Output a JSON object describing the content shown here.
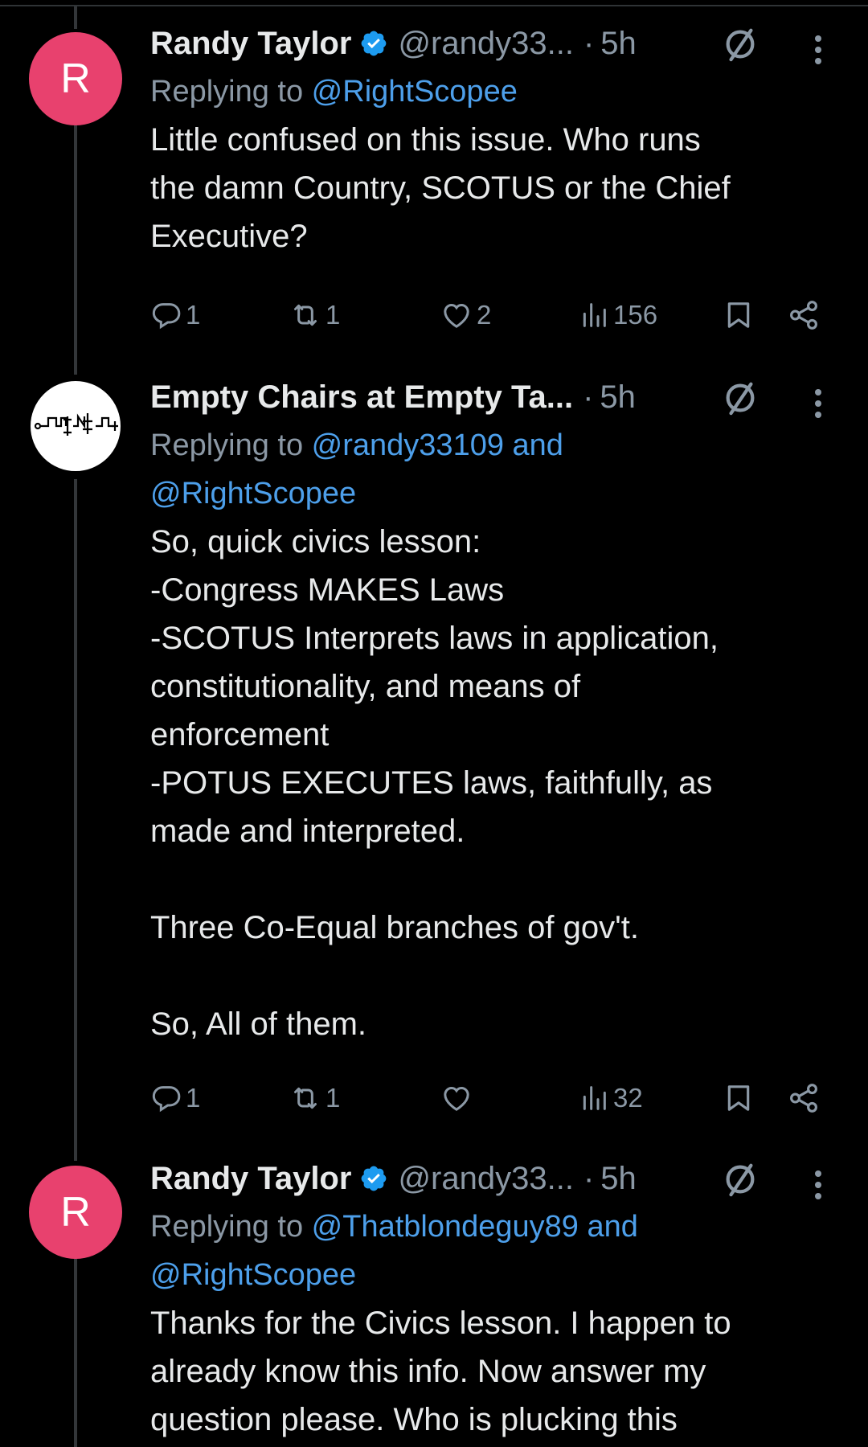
{
  "tweets": [
    {
      "name": "Randy Taylor",
      "handle": "@randy33...",
      "dot": "·",
      "time": "5h",
      "avatar_letter": "R",
      "reply_prefix": "Replying to ",
      "reply_to_1": "@RightScopee",
      "text": "Little confused on this issue. Who runs\nthe damn Country, SCOTUS or the Chief\nExecutive?",
      "replies": "1",
      "reposts": "1",
      "likes": "2",
      "views": "156"
    },
    {
      "name": "Empty Chairs at Empty Ta...",
      "dot": "·",
      "time": "5h",
      "reply_prefix": "Replying to ",
      "reply_to_1": "@randy33109 and",
      "reply_to_2": "@RightScopee",
      "text": "So, quick civics lesson:\n-Congress MAKES Laws\n-SCOTUS Interprets laws in application,\nconstitutionality, and means of\nenforcement\n-POTUS EXECUTES laws, faithfully, as\nmade and interpreted.\n\nThree Co-Equal branches of gov't.\n\nSo, All of them.",
      "replies": "1",
      "reposts": "1",
      "likes": "",
      "views": "32"
    },
    {
      "name": "Randy Taylor",
      "handle": "@randy33...",
      "dot": "·",
      "time": "5h",
      "avatar_letter": "R",
      "reply_prefix": "Replying to ",
      "reply_to_1": "@Thatblondeguy89 and",
      "reply_to_2": "@RightScopee",
      "text": "Thanks for the Civics lesson. I happen to\nalready know this info. Now answer my\nquestion please. Who is plucking this"
    }
  ],
  "colors": {
    "background": "#000000",
    "text": "#e7e9ea",
    "secondary": "#8b98a5",
    "link": "#4d9fea",
    "verified": "#1d9bf0",
    "avatar_pink": "#e8416e"
  },
  "icons": [
    "verified-badge-icon",
    "grok-icon",
    "more-icon",
    "reply-icon",
    "repost-icon",
    "like-icon",
    "views-icon",
    "bookmark-icon",
    "share-icon"
  ]
}
